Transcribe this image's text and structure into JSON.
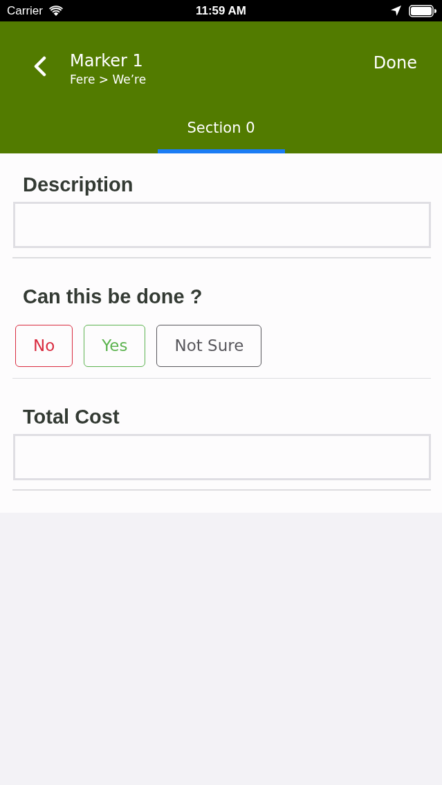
{
  "status_bar": {
    "carrier": "Carrier",
    "time": "11:59 AM"
  },
  "header": {
    "title": "Marker 1",
    "subtitle": "Fere > We’re",
    "done_button": "Done"
  },
  "tabs": [
    {
      "label": "Section 0",
      "selected": true
    }
  ],
  "form": {
    "fields": [
      {
        "kind": "text",
        "label": "Description"
      },
      {
        "kind": "choice",
        "label": "Can this be done ?",
        "options": [
          {
            "label": "No",
            "color": "#d92b3f",
            "selected": false
          },
          {
            "label": "Yes",
            "color": "#5cb34f",
            "selected": false
          },
          {
            "label": "Not Sure",
            "color": "#58575c",
            "selected": false
          }
        ]
      },
      {
        "kind": "text",
        "label": "Total Cost"
      }
    ]
  }
}
